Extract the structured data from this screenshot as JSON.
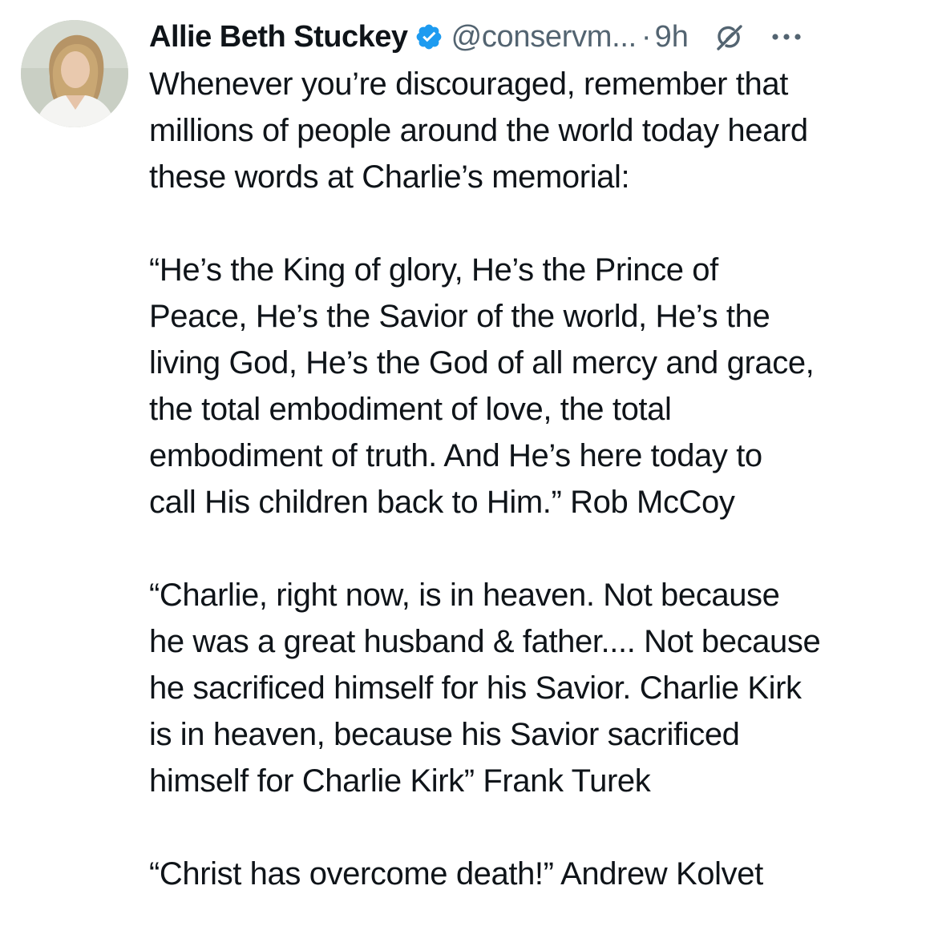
{
  "author": {
    "display_name": "Allie Beth Stuckey",
    "handle": "@conservm...",
    "separator": "·",
    "timestamp": "9h",
    "verified_color": "#1d9bf0"
  },
  "icons": {
    "verified": "verified-badge-icon",
    "grok": "grok-icon",
    "more": "more-options-icon"
  },
  "tweet": {
    "paragraphs": [
      [
        "Whenever you’re discouraged, remember that",
        "millions of people around the world today heard",
        "these words at Charlie’s memorial:"
      ],
      [
        "“He’s the King of glory, He’s the Prince of",
        "Peace, He’s the Savior of the world, He’s the",
        "living God, He’s the God of all mercy and grace,",
        "the total embodiment of love, the total",
        "embodiment of truth. And He’s here today to",
        "call His children back to Him.” Rob McCoy"
      ],
      [
        "“Charlie, right now, is in heaven. Not because",
        "he was a great husband & father.... Not because",
        "he sacrificed himself for his Savior. Charlie Kirk",
        "is in heaven, because his Savior sacrificed",
        "himself for Charlie Kirk” Frank Turek"
      ],
      [
        "“Christ has overcome death!” Andrew Kolvet"
      ]
    ]
  }
}
